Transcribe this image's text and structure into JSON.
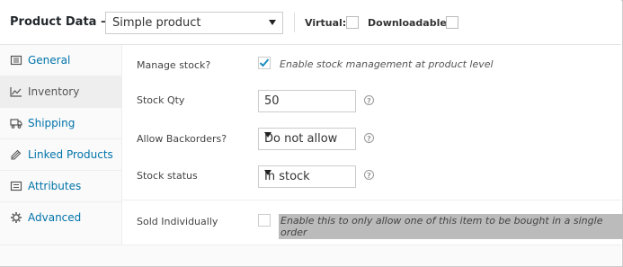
{
  "header": {
    "title": "Product Data —",
    "product_type": "Simple product",
    "virtual_label": "Virtual:",
    "downloadable_label": "Downloadable:"
  },
  "tabs": [
    {
      "label": "General",
      "icon": "wrench-icon"
    },
    {
      "label": "Inventory",
      "icon": "chart-icon"
    },
    {
      "label": "Shipping",
      "icon": "truck-icon"
    },
    {
      "label": "Linked Products",
      "icon": "link-icon"
    },
    {
      "label": "Attributes",
      "icon": "list-icon"
    },
    {
      "label": "Advanced",
      "icon": "gear-icon"
    }
  ],
  "active_tab": "Inventory",
  "inventory": {
    "manage_stock": {
      "label": "Manage stock?",
      "description": "Enable stock management at product level",
      "checked": true
    },
    "stock_qty": {
      "label": "Stock Qty",
      "value": "50"
    },
    "backorders": {
      "label": "Allow Backorders?",
      "value": "Do not allow"
    },
    "stock_status": {
      "label": "Stock status",
      "value": "In stock"
    },
    "sold_individually": {
      "label": "Sold Individually",
      "description": "Enable this to only allow one of this item to be bought in a single order",
      "checked": false
    }
  },
  "colors": {
    "link": "#0073aa",
    "checkmark": "#1e8cbe",
    "highlight": "#bbbbbb"
  }
}
